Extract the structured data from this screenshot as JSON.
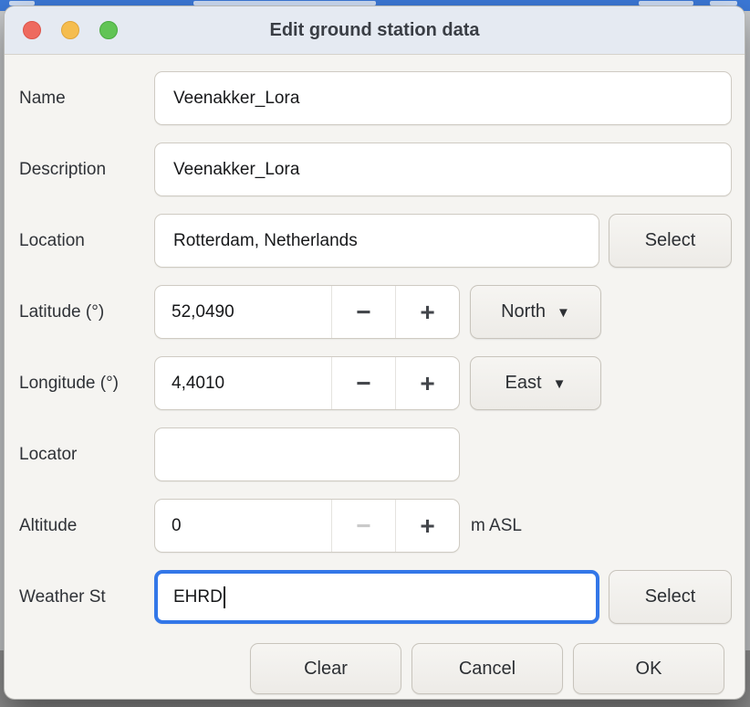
{
  "window": {
    "title": "Edit ground station data"
  },
  "traffic_lights": {
    "close": "#ee6a5f",
    "minimize": "#f5bd4f",
    "zoom": "#61c455"
  },
  "colors": {
    "accent_focus": "#3377e8",
    "dialog_bg": "#f5f4f1",
    "titlebar_bg": "#e5eaf2"
  },
  "fields": {
    "name": {
      "label": "Name",
      "value": "Veenakker_Lora"
    },
    "description": {
      "label": "Description",
      "value": "Veenakker_Lora"
    },
    "location": {
      "label": "Location",
      "value": "Rotterdam, Netherlands",
      "select_label": "Select"
    },
    "latitude": {
      "label": "Latitude (°)",
      "value": "52,0490",
      "minus": "−",
      "plus": "+",
      "direction": "North",
      "arrow": "▼"
    },
    "longitude": {
      "label": "Longitude (°)",
      "value": "4,4010",
      "minus": "−",
      "plus": "+",
      "direction": "East",
      "arrow": "▼"
    },
    "locator": {
      "label": "Locator",
      "value": ""
    },
    "altitude": {
      "label": "Altitude",
      "value": "0",
      "minus": "−",
      "plus": "+",
      "unit": "m ASL"
    },
    "weather_station": {
      "label": "Weather St",
      "value": "EHRD",
      "select_label": "Select"
    }
  },
  "footer": {
    "clear_label": "Clear",
    "cancel_label": "Cancel",
    "ok_label": "OK"
  }
}
